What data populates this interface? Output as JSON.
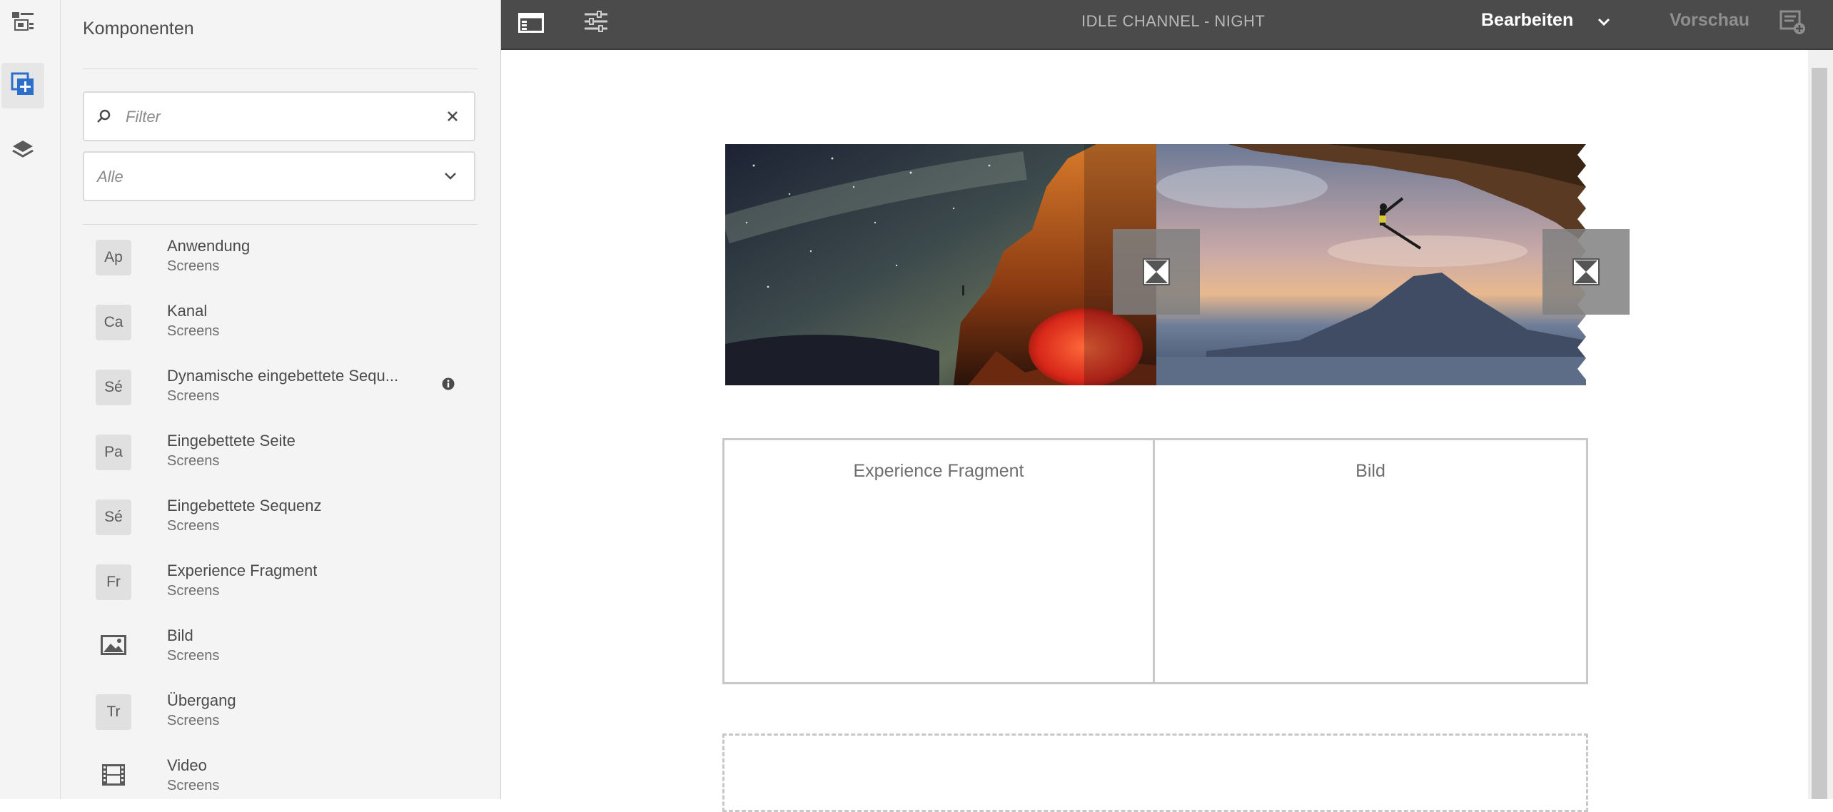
{
  "rail": {
    "items": [
      {
        "name": "content-tree-icon"
      },
      {
        "name": "components-icon",
        "active": true
      },
      {
        "name": "layers-icon"
      }
    ]
  },
  "panel": {
    "title": "Komponenten",
    "filter_placeholder": "Filter",
    "group_select_value": "Alle",
    "components": [
      {
        "badge": "Ap",
        "name": "Anwendung",
        "group": "Screens"
      },
      {
        "badge": "Ca",
        "name": "Kanal",
        "group": "Screens"
      },
      {
        "badge": "Sé",
        "name": "Dynamische eingebettete Sequ...",
        "group": "Screens",
        "info": true
      },
      {
        "badge": "Pa",
        "name": "Eingebettete Seite",
        "group": "Screens"
      },
      {
        "badge": "Sé",
        "name": "Eingebettete Sequenz",
        "group": "Screens"
      },
      {
        "badge": "Fr",
        "name": "Experience Fragment",
        "group": "Screens"
      },
      {
        "badge": "",
        "icon": "image-icon",
        "name": "Bild",
        "group": "Screens"
      },
      {
        "badge": "Tr",
        "name": "Übergang",
        "group": "Screens"
      },
      {
        "badge": "",
        "icon": "film-icon",
        "name": "Video",
        "group": "Screens"
      }
    ]
  },
  "topbar": {
    "title": "IDLE CHANNEL - NIGHT",
    "mode": "Bearbeiten",
    "preview": "Vorschau"
  },
  "editor": {
    "cells": [
      "Experience Fragment",
      "Bild"
    ]
  },
  "colors": {
    "topbar_bg": "#4b4b4b",
    "panel_bg": "#f4f4f4",
    "accent_blue": "#2c6ecb"
  }
}
